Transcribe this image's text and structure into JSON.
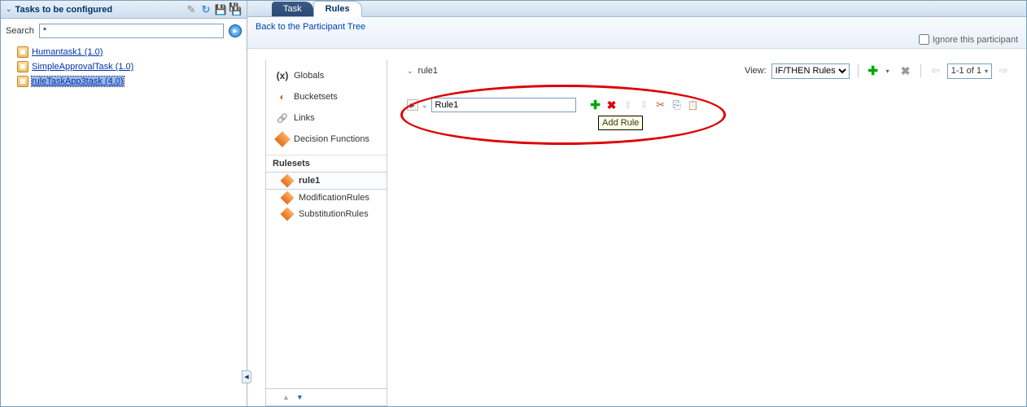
{
  "left_panel": {
    "title": "Tasks to be configured",
    "search_label": "Search",
    "search_value": "*",
    "tasks": [
      {
        "label": "Humantask1 (1.0)"
      },
      {
        "label": "SimpleApprovalTask (1.0)"
      },
      {
        "label": "ruleTaskApp3task (4.0)"
      }
    ]
  },
  "tabs": {
    "task": "Task",
    "rules": "Rules"
  },
  "back_link": "Back to the Participant Tree",
  "ignore_label": "Ignore this participant",
  "rules_nav": {
    "globals": "Globals",
    "globals_icon": "(x)",
    "bucketsets": "Bucketsets",
    "links": "Links",
    "decision_functions": "Decision Functions",
    "rulesets_header": "Rulesets",
    "rulesets": [
      {
        "label": "rule1"
      },
      {
        "label": "ModificationRules"
      },
      {
        "label": "SubstitutionRules"
      }
    ]
  },
  "editor": {
    "ruleset_name": "rule1",
    "view_label": "View:",
    "view_option": "IF/THEN Rules",
    "pager": "1-1 of 1",
    "rule_name": "Rule1",
    "tooltip": "Add Rule"
  }
}
